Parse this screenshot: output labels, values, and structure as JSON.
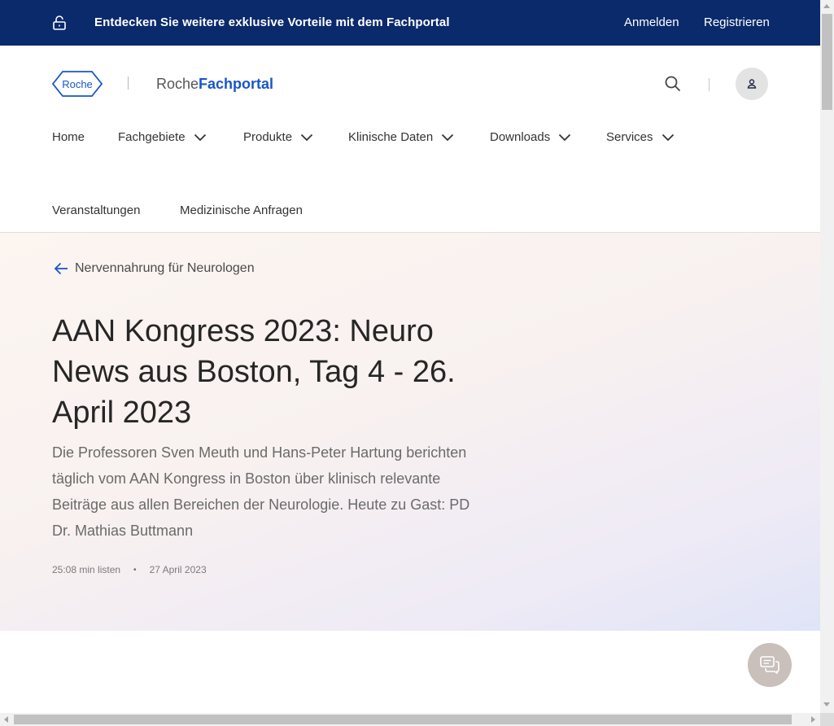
{
  "banner": {
    "promo": "Entdecken Sie weitere exklusive Vorteile mit dem Fachportal",
    "login": "Anmelden",
    "register": "Registrieren",
    "background": "#0b2a6b"
  },
  "header": {
    "logo_text": "Roche",
    "brand_prefix": "Roche",
    "brand_suffix": "Fachportal",
    "brand_color": "#1a55c9",
    "icons": [
      "search-icon",
      "user-icon"
    ]
  },
  "nav": {
    "row1": [
      {
        "label": "Home"
      },
      {
        "label": "Fachgebiete"
      },
      {
        "label": "Produkte"
      },
      {
        "label": "Klinische Daten"
      },
      {
        "label": "Downloads"
      },
      {
        "label": "Services"
      }
    ],
    "row2": [
      {
        "label": "Veranstaltungen"
      },
      {
        "label": "Medizinische Anfragen"
      }
    ]
  },
  "hero": {
    "back_label": "Nervennahrung für Neurologen",
    "title": "AAN Kongress 2023: Neuro News aus Boston, Tag 4 - 26. April 2023",
    "description": "Die Professoren Sven Meuth und Hans-Peter Hartung berichten täglich vom AAN Kongress in Boston über klinisch relevante Beiträge aus allen Bereichen der Neurologie. Heute zu Gast: PD Dr. Mathias Buttmann",
    "duration": "25:08 min listen",
    "separator": "•",
    "date": "27 April 2023"
  },
  "chat": {
    "icon": "chat-icon"
  }
}
